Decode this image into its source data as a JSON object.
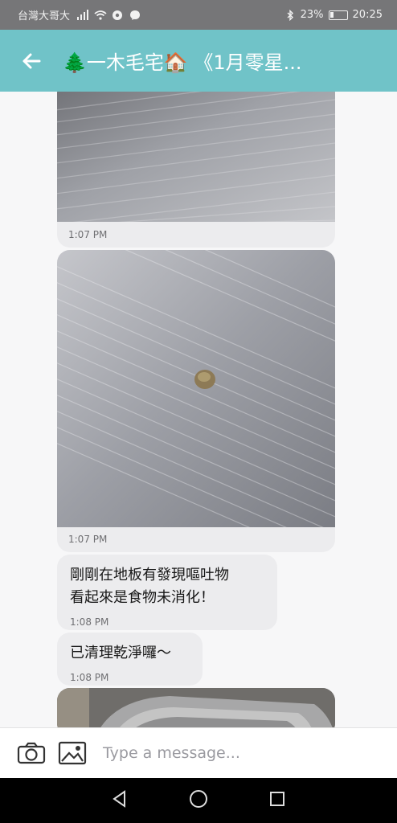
{
  "status_bar": {
    "carrier": "台灣大哥大",
    "battery_text": "23%",
    "battery_level": 0.23,
    "time": "20:25",
    "icons": [
      "signal-icon",
      "wifi-icon",
      "chrome-icon",
      "messenger-icon",
      "bluetooth-icon",
      "battery-icon"
    ]
  },
  "header": {
    "title": "🌲一木毛宅🏠 《1月零星..."
  },
  "messages": [
    {
      "type": "image",
      "time": "1:07 PM"
    },
    {
      "type": "image",
      "time": "1:07 PM"
    },
    {
      "type": "text",
      "lines": [
        "剛剛在地板有發現嘔吐物",
        "看起來是食物未消化！"
      ],
      "time": "1:08 PM"
    },
    {
      "type": "text",
      "lines": [
        "已清理乾淨囉～"
      ],
      "time": "1:08 PM"
    }
  ],
  "composer": {
    "placeholder": "Type a message..."
  },
  "colors": {
    "header": "#70c3c8",
    "status_bar": "#767678",
    "bubble": "#ececee",
    "background": "#f7f7f8"
  }
}
